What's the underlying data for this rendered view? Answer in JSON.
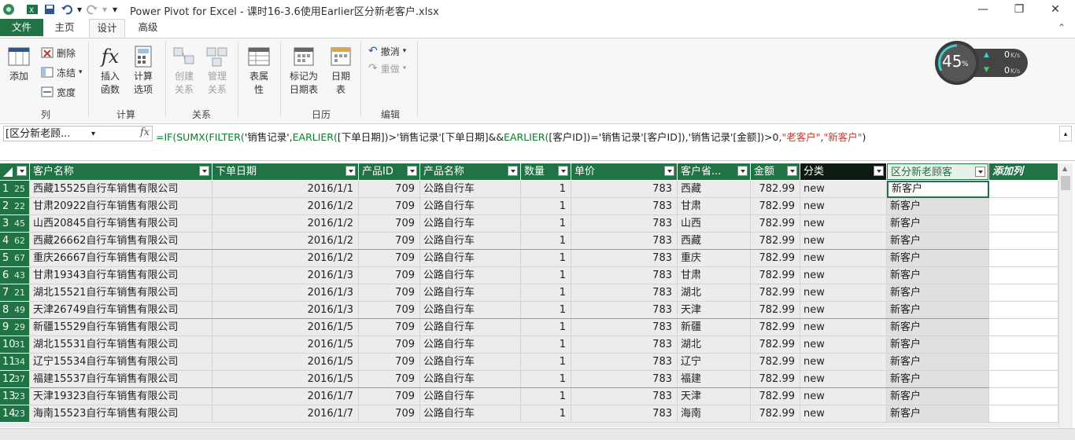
{
  "window": {
    "title": "Power Pivot for Excel - 课时16-3.6使用Earlier区分新老客户.xlsx"
  },
  "tabs": [
    "文件",
    "主页",
    "设计",
    "高级"
  ],
  "ribbon": {
    "add_label": "添加",
    "delete_label": "删除",
    "freeze_label": "冻结",
    "width_label": "宽度",
    "group_column": "列",
    "insert_function_label": "插入函数",
    "calc_options_label": "计算选项",
    "group_calc": "计算",
    "create_relationship_label": "创建关系",
    "manage_relationship_label": "管理关系",
    "group_relationship": "关系",
    "table_properties_label": "表属性",
    "mark_date_table_label": "标记为日期表",
    "date_table_label": "日期表",
    "group_calendar": "日历",
    "undo_label": "撤消",
    "redo_label": "重做",
    "group_edit": "编辑"
  },
  "gauge": {
    "percent": "45",
    "unit": "%",
    "up": "0",
    "down": "0",
    "rate_unit": "K/s"
  },
  "formula_bar": {
    "name_box": "[区分新老顾...",
    "fx": "fx",
    "formula_parts": [
      {
        "t": "=IF(",
        "c": "kw"
      },
      {
        "t": "SUMX(",
        "c": "kw"
      },
      {
        "t": "FILTER(",
        "c": "kw"
      },
      {
        "t": "'销售记录',",
        "c": "txt"
      },
      {
        "t": "EARLIER(",
        "c": "kw"
      },
      {
        "t": "[下单日期])>'销售记录'[下单日期]&&",
        "c": "txt"
      },
      {
        "t": "EARLIER(",
        "c": "kw"
      },
      {
        "t": "[客户ID])='销售记录'[客户ID]),'销售记录'[金额])>0,",
        "c": "txt"
      },
      {
        "t": "\"老客户\"",
        "c": "str"
      },
      {
        "t": ",",
        "c": "txt"
      },
      {
        "t": "\"新客户\"",
        "c": "str"
      },
      {
        "t": ")",
        "c": "txt"
      }
    ]
  },
  "grid": {
    "columns": [
      "",
      "客户名称",
      "下单日期",
      "产品ID",
      "产品名称",
      "数量",
      "单价",
      "客户省...",
      "金额",
      "分类",
      "区分新老顾客",
      "添加列"
    ],
    "rows": [
      [
        "1",
        "25",
        "西藏15525自行车销售有限公司",
        "2016/1/1",
        "709",
        "公路自行车",
        "1",
        "783",
        "西藏",
        "782.99",
        "new",
        "新客户"
      ],
      [
        "2",
        "22",
        "甘肃20922自行车销售有限公司",
        "2016/1/2",
        "709",
        "公路自行车",
        "1",
        "783",
        "甘肃",
        "782.99",
        "new",
        "新客户"
      ],
      [
        "3",
        "45",
        "山西20845自行车销售有限公司",
        "2016/1/2",
        "709",
        "公路自行车",
        "1",
        "783",
        "山西",
        "782.99",
        "new",
        "新客户"
      ],
      [
        "4",
        "62",
        "西藏26662自行车销售有限公司",
        "2016/1/2",
        "709",
        "公路自行车",
        "1",
        "783",
        "西藏",
        "782.99",
        "new",
        "新客户"
      ],
      [
        "5",
        "67",
        "重庆26667自行车销售有限公司",
        "2016/1/2",
        "709",
        "公路自行车",
        "1",
        "783",
        "重庆",
        "782.99",
        "new",
        "新客户"
      ],
      [
        "6",
        "43",
        "甘肃19343自行车销售有限公司",
        "2016/1/3",
        "709",
        "公路自行车",
        "1",
        "783",
        "甘肃",
        "782.99",
        "new",
        "新客户"
      ],
      [
        "7",
        "21",
        "湖北15521自行车销售有限公司",
        "2016/1/3",
        "709",
        "公路自行车",
        "1",
        "783",
        "湖北",
        "782.99",
        "new",
        "新客户"
      ],
      [
        "8",
        "49",
        "天津26749自行车销售有限公司",
        "2016/1/3",
        "709",
        "公路自行车",
        "1",
        "783",
        "天津",
        "782.99",
        "new",
        "新客户"
      ],
      [
        "9",
        "29",
        "新疆15529自行车销售有限公司",
        "2016/1/5",
        "709",
        "公路自行车",
        "1",
        "783",
        "新疆",
        "782.99",
        "new",
        "新客户"
      ],
      [
        "10",
        "31",
        "湖北15531自行车销售有限公司",
        "2016/1/5",
        "709",
        "公路自行车",
        "1",
        "783",
        "湖北",
        "782.99",
        "new",
        "新客户"
      ],
      [
        "11",
        "34",
        "辽宁15534自行车销售有限公司",
        "2016/1/5",
        "709",
        "公路自行车",
        "1",
        "783",
        "辽宁",
        "782.99",
        "new",
        "新客户"
      ],
      [
        "12",
        "37",
        "福建15537自行车销售有限公司",
        "2016/1/5",
        "709",
        "公路自行车",
        "1",
        "783",
        "福建",
        "782.99",
        "new",
        "新客户"
      ],
      [
        "13",
        "23",
        "天津19323自行车销售有限公司",
        "2016/1/7",
        "709",
        "公路自行车",
        "1",
        "783",
        "天津",
        "782.99",
        "new",
        "新客户"
      ],
      [
        "14",
        "23",
        "海南15523自行车销售有限公司",
        "2016/1/7",
        "709",
        "公路自行车",
        "1",
        "783",
        "海南",
        "782.99",
        "new",
        "新客户"
      ]
    ]
  },
  "colors": {
    "accent": "#217346"
  }
}
